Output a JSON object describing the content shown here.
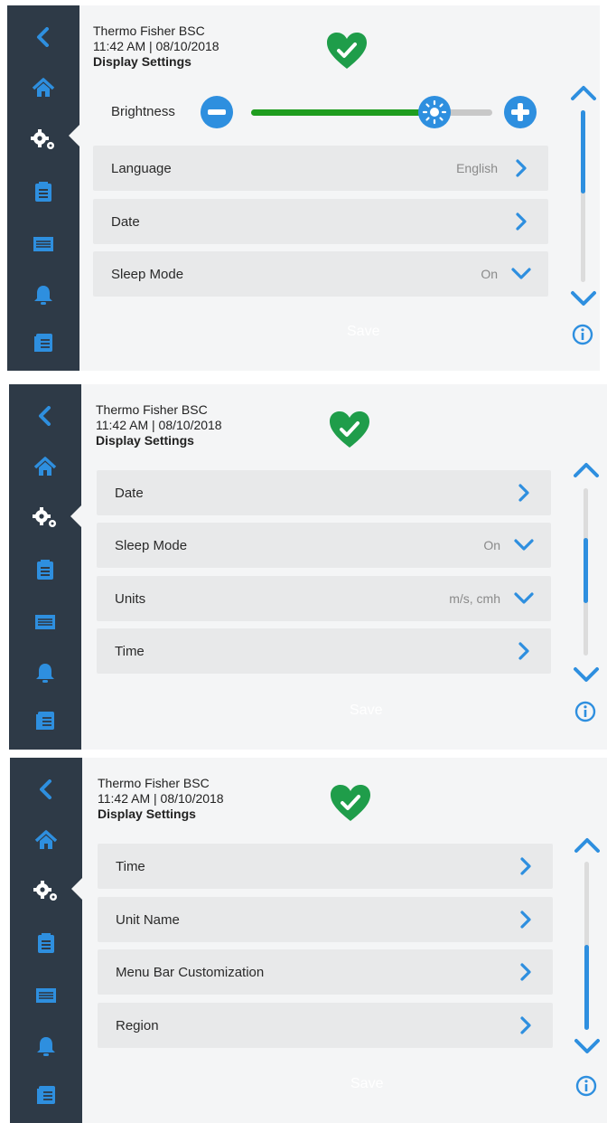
{
  "colors": {
    "sidebar": "#2e3a47",
    "accent": "#2e8fdf",
    "health": "#1f9d4a",
    "row": "#e8e9ea",
    "background": "#f4f5f6"
  },
  "screens": [
    {
      "header": {
        "device": "Thermo Fisher BSC",
        "datetime": "11:42  AM | 08/10/2018",
        "title": "Display Settings"
      },
      "brightness": {
        "label": "Brightness",
        "level_percent": 76
      },
      "rows": [
        {
          "label": "Language",
          "value": "English",
          "icon": "chevron-right-icon"
        },
        {
          "label": "Date",
          "value": "",
          "icon": "chevron-right-icon"
        },
        {
          "label": "Sleep Mode",
          "value": "On",
          "icon": "chevron-down-icon"
        }
      ],
      "save_label": "Save",
      "scroll": {
        "position": "top"
      }
    },
    {
      "header": {
        "device": "Thermo Fisher BSC",
        "datetime": "11:42  AM | 08/10/2018",
        "title": "Display Settings"
      },
      "rows": [
        {
          "label": "Date",
          "value": "",
          "icon": "chevron-right-icon"
        },
        {
          "label": "Sleep Mode",
          "value": "On",
          "icon": "chevron-down-icon"
        },
        {
          "label": "Units",
          "value": "m/s, cmh",
          "icon": "chevron-down-icon"
        },
        {
          "label": "Time",
          "value": "",
          "icon": "chevron-right-icon"
        }
      ],
      "save_label": "Save",
      "scroll": {
        "position": "middle"
      }
    },
    {
      "header": {
        "device": "Thermo Fisher BSC",
        "datetime": "11:42  AM | 08/10/2018",
        "title": "Display Settings"
      },
      "rows": [
        {
          "label": "Time",
          "value": "",
          "icon": "chevron-right-icon"
        },
        {
          "label": "Unit Name",
          "value": "",
          "icon": "chevron-right-icon"
        },
        {
          "label": "Menu Bar Customization",
          "value": "",
          "icon": "chevron-right-icon"
        },
        {
          "label": "Region",
          "value": "",
          "icon": "chevron-right-icon"
        }
      ],
      "save_label": "Save",
      "scroll": {
        "position": "bottom"
      }
    }
  ],
  "sidebar": {
    "items": [
      {
        "icon": "back-icon"
      },
      {
        "icon": "home-icon"
      },
      {
        "icon": "settings-icon",
        "active": true
      },
      {
        "icon": "clipboard-icon"
      },
      {
        "icon": "filter-icon"
      },
      {
        "icon": "bell-icon"
      },
      {
        "icon": "log-icon"
      }
    ]
  }
}
